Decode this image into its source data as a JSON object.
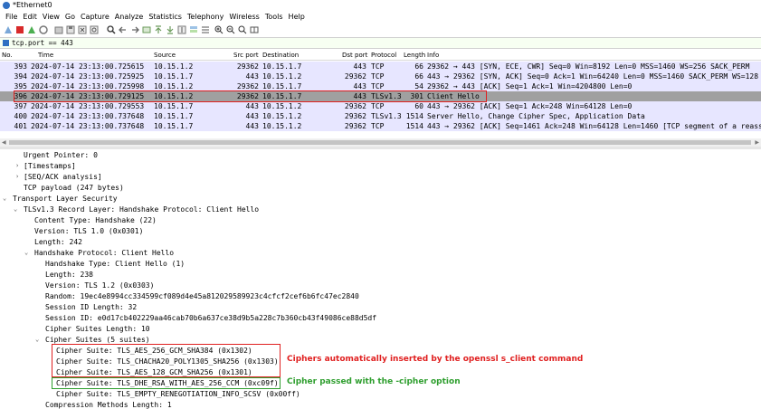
{
  "window": {
    "title": "*Ethernet0"
  },
  "menu": [
    "File",
    "Edit",
    "View",
    "Go",
    "Capture",
    "Analyze",
    "Statistics",
    "Telephony",
    "Wireless",
    "Tools",
    "Help"
  ],
  "filter": {
    "value": "tcp.port == 443"
  },
  "columns": {
    "no": "No.",
    "time": "Time",
    "source": "Source",
    "src_port": "Src port",
    "destination": "Destination",
    "dst_port": "Dst port",
    "protocol": "Protocol",
    "length": "Length",
    "info": "Info"
  },
  "packets": [
    {
      "no": "393",
      "time": "2024-07-14 23:13:00.725615",
      "source": "10.15.1.2",
      "src_port": "29362",
      "destination": "10.15.1.7",
      "dst_port": "443",
      "protocol": "TCP",
      "length": "66",
      "info": "29362 → 443 [SYN, ECE, CWR] Seq=0 Win=8192 Len=0 MSS=1460 WS=256 SACK_PERM"
    },
    {
      "no": "394",
      "time": "2024-07-14 23:13:00.725925",
      "source": "10.15.1.7",
      "src_port": "443",
      "destination": "10.15.1.2",
      "dst_port": "29362",
      "protocol": "TCP",
      "length": "66",
      "info": "443 → 29362 [SYN, ACK] Seq=0 Ack=1 Win=64240 Len=0 MSS=1460 SACK_PERM WS=128"
    },
    {
      "no": "395",
      "time": "2024-07-14 23:13:00.725998",
      "source": "10.15.1.2",
      "src_port": "29362",
      "destination": "10.15.1.7",
      "dst_port": "443",
      "protocol": "TCP",
      "length": "54",
      "info": "29362 → 443 [ACK] Seq=1 Ack=1 Win=4204800 Len=0"
    },
    {
      "no": "396",
      "time": "2024-07-14 23:13:00.729125",
      "source": "10.15.1.2",
      "src_port": "29362",
      "destination": "10.15.1.7",
      "dst_port": "443",
      "protocol": "TLSv1.3",
      "length": "301",
      "info": "Client Hello"
    },
    {
      "no": "397",
      "time": "2024-07-14 23:13:00.729553",
      "source": "10.15.1.7",
      "src_port": "443",
      "destination": "10.15.1.2",
      "dst_port": "29362",
      "protocol": "TCP",
      "length": "60",
      "info": "443 → 29362 [ACK] Seq=1 Ack=248 Win=64128 Len=0"
    },
    {
      "no": "400",
      "time": "2024-07-14 23:13:00.737648",
      "source": "10.15.1.7",
      "src_port": "443",
      "destination": "10.15.1.2",
      "dst_port": "29362",
      "protocol": "TLSv1.3",
      "length": "1514",
      "info": "Server Hello, Change Cipher Spec, Application Data"
    },
    {
      "no": "401",
      "time": "2024-07-14 23:13:00.737648",
      "source": "10.15.1.7",
      "src_port": "443",
      "destination": "10.15.1.2",
      "dst_port": "29362",
      "protocol": "TCP",
      "length": "1514",
      "info": "443 → 29362 [ACK] Seq=1461 Ack=248 Win=64128 Len=1460 [TCP segment of a reasse"
    }
  ],
  "details": [
    {
      "text": "Urgent Pointer: 0"
    },
    {
      "text": "[Timestamps]"
    },
    {
      "text": "[SEQ/ACK analysis]"
    },
    {
      "text": "TCP payload (247 bytes)"
    },
    {
      "text": "Transport Layer Security"
    },
    {
      "text": "TLSv1.3 Record Layer: Handshake Protocol: Client Hello"
    },
    {
      "text": "Content Type: Handshake (22)"
    },
    {
      "text": "Version: TLS 1.0 (0x0301)"
    },
    {
      "text": "Length: 242"
    },
    {
      "text": "Handshake Protocol: Client Hello"
    },
    {
      "text": "Handshake Type: Client Hello (1)"
    },
    {
      "text": "Length: 238"
    },
    {
      "text": "Version: TLS 1.2 (0x0303)"
    },
    {
      "text": "Random: 19ec4e8994cc334599cf089d4e45a812029589923c4cfcf2cef6b6fc47ec2840"
    },
    {
      "text": "Session ID Length: 32"
    },
    {
      "text": "Session ID: e0d17cb402229aa46cab70b6a637ce38d9b5a228c7b360cb43f49086ce88d5df"
    },
    {
      "text": "Cipher Suites Length: 10"
    },
    {
      "text": "Cipher Suites (5 suites)"
    },
    {
      "text": "Cipher Suite: TLS_AES_256_GCM_SHA384 (0x1302)"
    },
    {
      "text": "Cipher Suite: TLS_CHACHA20_POLY1305_SHA256 (0x1303)"
    },
    {
      "text": "Cipher Suite: TLS_AES_128_GCM_SHA256 (0x1301)"
    },
    {
      "text": "Cipher Suite: TLS_DHE_RSA_WITH_AES_256_CCM (0xc09f)"
    },
    {
      "text": "Cipher Suite: TLS_EMPTY_RENEGOTIATION_INFO_SCSV (0x00ff)"
    },
    {
      "text": "Compression Methods Length: 1"
    }
  ],
  "annotations": {
    "red": "Ciphers automatically inserted by the openssl s_client command",
    "green": "Cipher passed with the -cipher option"
  },
  "colors": {
    "red": "#e02020",
    "green": "#2e9e2e",
    "selected_row": "#a0a0a0",
    "tcp_row": "#e7e6ff"
  }
}
